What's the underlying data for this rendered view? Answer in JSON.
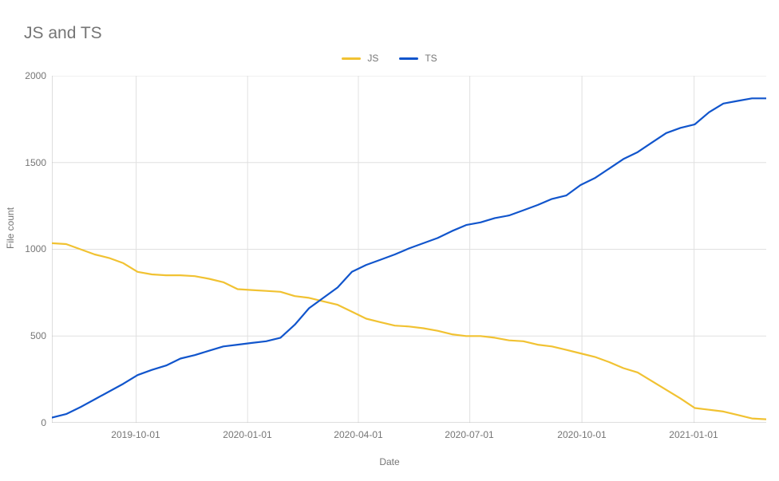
{
  "chart_data": {
    "type": "line",
    "title": "JS and TS",
    "xlabel": "Date",
    "ylabel": "File count",
    "ylim": [
      0,
      2000
    ],
    "x_tick_labels": [
      "2019-10-01",
      "2020-01-01",
      "2020-04-01",
      "2020-07-01",
      "2020-10-01",
      "2021-01-01"
    ],
    "x_tick_positions": [
      0.118,
      0.274,
      0.429,
      0.585,
      0.742,
      0.899
    ],
    "y_ticks": [
      0,
      500,
      1000,
      1500,
      2000
    ],
    "legend": [
      {
        "name": "JS",
        "color": "#f1c232"
      },
      {
        "name": "TS",
        "color": "#1155cc"
      }
    ],
    "x": [
      0.0,
      0.02,
      0.04,
      0.06,
      0.08,
      0.1,
      0.12,
      0.14,
      0.16,
      0.18,
      0.2,
      0.22,
      0.24,
      0.26,
      0.28,
      0.3,
      0.32,
      0.34,
      0.36,
      0.38,
      0.4,
      0.42,
      0.44,
      0.46,
      0.48,
      0.5,
      0.52,
      0.54,
      0.56,
      0.58,
      0.6,
      0.62,
      0.64,
      0.66,
      0.68,
      0.7,
      0.72,
      0.74,
      0.76,
      0.78,
      0.8,
      0.82,
      0.84,
      0.86,
      0.88,
      0.9,
      0.92,
      0.94,
      0.96,
      0.98,
      1.0
    ],
    "series": [
      {
        "name": "JS",
        "color": "#f1c232",
        "values": [
          1035,
          1030,
          1000,
          970,
          950,
          920,
          870,
          855,
          850,
          850,
          845,
          830,
          810,
          770,
          765,
          760,
          755,
          730,
          720,
          700,
          680,
          640,
          600,
          580,
          560,
          555,
          545,
          530,
          510,
          500,
          500,
          490,
          475,
          470,
          450,
          440,
          420,
          400,
          380,
          350,
          315,
          290,
          240,
          190,
          140,
          85,
          75,
          65,
          45,
          25,
          20
        ]
      },
      {
        "name": "TS",
        "color": "#1155cc",
        "values": [
          30,
          50,
          90,
          135,
          180,
          225,
          275,
          305,
          330,
          370,
          390,
          415,
          440,
          450,
          460,
          470,
          490,
          565,
          660,
          720,
          780,
          870,
          910,
          940,
          970,
          1005,
          1035,
          1065,
          1105,
          1140,
          1155,
          1180,
          1195,
          1225,
          1255,
          1290,
          1310,
          1370,
          1410,
          1465,
          1520,
          1560,
          1615,
          1670,
          1700,
          1720,
          1790,
          1840,
          1855,
          1870,
          1870
        ]
      }
    ]
  }
}
